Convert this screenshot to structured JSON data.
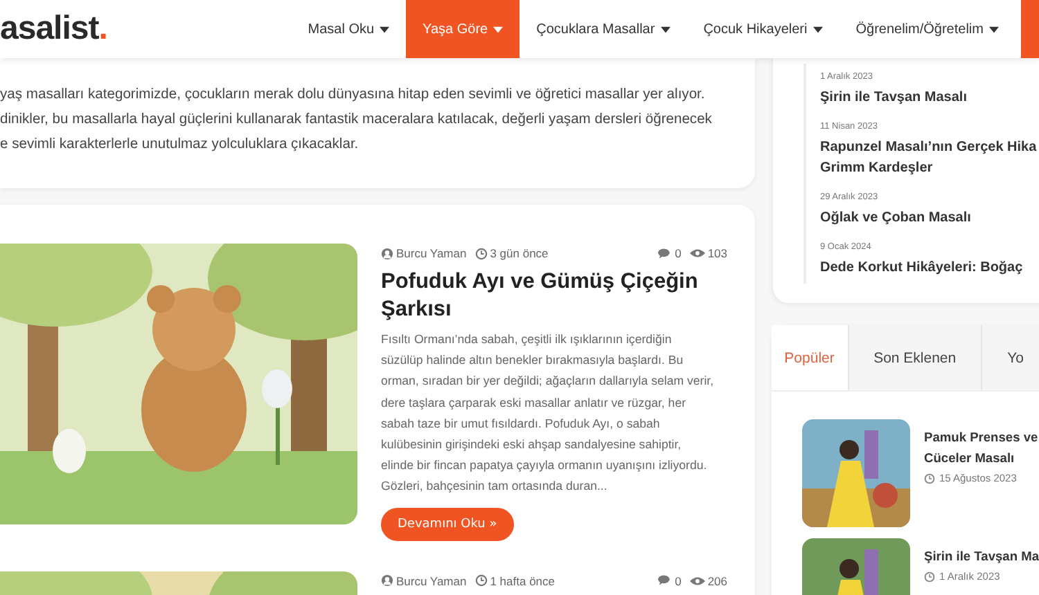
{
  "header": {
    "logo": "asalist",
    "logo_dot": ".",
    "nav": [
      {
        "label": "Masal Oku",
        "selected": false
      },
      {
        "label": "Yaşa Göre",
        "selected": true
      },
      {
        "label": "Çocuklara Masallar",
        "selected": false
      },
      {
        "label": "Çocuk Hikayeleri",
        "selected": false
      },
      {
        "label": "Öğrenelim/Öğretelim",
        "selected": false
      }
    ]
  },
  "intro": {
    "lines": [
      "yaş masalları kategorimizde, çocukların merak dolu dünyasına hitap eden sevimli ve öğretici masallar yer alıyor.",
      "dinikler, bu masallarla hayal güçlerini kullanarak fantastik maceralara katılacak, değerli yaşam dersleri öğrenecek",
      "e sevimli karakterlerle unutulmaz yolculuklara çıkacaklar."
    ]
  },
  "articles": [
    {
      "author": "Burcu Yaman",
      "time": "3 gün önce",
      "comments": "0",
      "views": "103",
      "title": "Pofuduk Ayı ve Gümüş Çiçeğin Şarkısı",
      "excerpt": [
        "Fısıltı Ormanı’nda sabah, çeşitli ilk ışıklarının içerdiğin",
        "süzülüp halinde altın benekler bırakmasıyla başlardı. Bu",
        "orman, sıradan bir yer değildi; ağaçların dallarıyla selam verir,",
        "dere taşlara çarparak eski masallar anlatır ve rüzgar, her",
        "sabah taze bir umut fısıldardı. Pofuduk Ayı, o sabah",
        "kulübesinin girişindeki eski ahşap sandalyesine sahiptir,",
        "elinde bir fincan papatya çayıyla ormanın uyanışını izliyordu.",
        "Gözleri, bahçesinin tam ortasında duran..."
      ],
      "button": "Devamını Oku »"
    },
    {
      "author": "Burcu Yaman",
      "time": "1 hafta önce",
      "comments": "0",
      "views": "206"
    }
  ],
  "timeline": [
    {
      "date": "1 Aralık 2023",
      "title_lines": [
        "Şirin ile Tavşan Masalı"
      ]
    },
    {
      "date": "11 Nisan 2023",
      "title_lines": [
        "Rapunzel Masalı’nın Gerçek Hika",
        "Grimm Kardeşler"
      ]
    },
    {
      "date": "29 Aralık 2023",
      "title_lines": [
        "Oğlak ve Çoban Masalı"
      ]
    },
    {
      "date": "9 Ocak 2024",
      "title_lines": [
        "Dede Korkut Hikâyeleri: Boğaç"
      ]
    }
  ],
  "tabs": [
    {
      "label": "Popüler",
      "selected": true
    },
    {
      "label": "Son Eklenen",
      "selected": false
    },
    {
      "label": "Yo",
      "selected": false
    }
  ],
  "posts": [
    {
      "title_lines": [
        "Pamuk Prenses ve",
        "Cüceler Masalı"
      ],
      "date": "15 Ağustos 2023"
    },
    {
      "title_lines": [
        "Şirin ile Tavşan Ma"
      ],
      "date": "1 Aralık 2023"
    }
  ]
}
